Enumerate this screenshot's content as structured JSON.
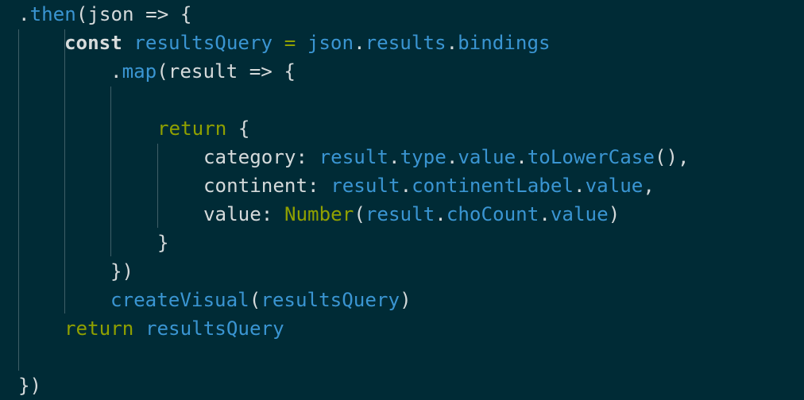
{
  "editor": {
    "theme": {
      "background": "#002b36",
      "text": "#d5dadb",
      "identifier": "#3a95d2",
      "keyword_green": "#8fa000",
      "indent_guide": "#3f5f68"
    },
    "lines": [
      {
        "indent": 0,
        "tokens": [
          {
            "t": ".",
            "c": "plain"
          },
          {
            "t": "then",
            "c": "blue"
          },
          {
            "t": "(json => {",
            "c": "plain"
          }
        ]
      },
      {
        "indent": 2,
        "tokens": [
          {
            "t": "const",
            "c": "keyword"
          },
          {
            "t": " ",
            "c": "plain"
          },
          {
            "t": "resultsQuery",
            "c": "blue"
          },
          {
            "t": " ",
            "c": "plain"
          },
          {
            "t": "=",
            "c": "green"
          },
          {
            "t": " ",
            "c": "plain"
          },
          {
            "t": "json",
            "c": "blue"
          },
          {
            "t": ".",
            "c": "plain"
          },
          {
            "t": "results",
            "c": "blue"
          },
          {
            "t": ".",
            "c": "plain"
          },
          {
            "t": "bindings",
            "c": "blue"
          }
        ]
      },
      {
        "indent": 4,
        "tokens": [
          {
            "t": ".",
            "c": "plain"
          },
          {
            "t": "map",
            "c": "blue"
          },
          {
            "t": "(result => {",
            "c": "plain"
          }
        ]
      },
      {
        "indent": 4,
        "tokens": []
      },
      {
        "indent": 6,
        "tokens": [
          {
            "t": "return",
            "c": "green"
          },
          {
            "t": " {",
            "c": "plain"
          }
        ]
      },
      {
        "indent": 8,
        "tokens": [
          {
            "t": "category: ",
            "c": "plain"
          },
          {
            "t": "result",
            "c": "blue"
          },
          {
            "t": ".",
            "c": "plain"
          },
          {
            "t": "type",
            "c": "blue"
          },
          {
            "t": ".",
            "c": "plain"
          },
          {
            "t": "value",
            "c": "blue"
          },
          {
            "t": ".",
            "c": "plain"
          },
          {
            "t": "toLowerCase",
            "c": "blue"
          },
          {
            "t": "(),",
            "c": "plain"
          }
        ]
      },
      {
        "indent": 8,
        "tokens": [
          {
            "t": "continent: ",
            "c": "plain"
          },
          {
            "t": "result",
            "c": "blue"
          },
          {
            "t": ".",
            "c": "plain"
          },
          {
            "t": "continentLabel",
            "c": "blue"
          },
          {
            "t": ".",
            "c": "plain"
          },
          {
            "t": "value",
            "c": "blue"
          },
          {
            "t": ",",
            "c": "plain"
          }
        ]
      },
      {
        "indent": 8,
        "tokens": [
          {
            "t": "value: ",
            "c": "plain"
          },
          {
            "t": "Number",
            "c": "green"
          },
          {
            "t": "(",
            "c": "plain"
          },
          {
            "t": "result",
            "c": "blue"
          },
          {
            "t": ".",
            "c": "plain"
          },
          {
            "t": "choCount",
            "c": "blue"
          },
          {
            "t": ".",
            "c": "plain"
          },
          {
            "t": "value",
            "c": "blue"
          },
          {
            "t": ")",
            "c": "plain"
          }
        ]
      },
      {
        "indent": 6,
        "tokens": [
          {
            "t": "}",
            "c": "plain"
          }
        ]
      },
      {
        "indent": 4,
        "tokens": [
          {
            "t": "})",
            "c": "plain"
          }
        ]
      },
      {
        "indent": 4,
        "tokens": [
          {
            "t": "createVisual",
            "c": "blue"
          },
          {
            "t": "(",
            "c": "plain"
          },
          {
            "t": "resultsQuery",
            "c": "blue"
          },
          {
            "t": ")",
            "c": "plain"
          }
        ]
      },
      {
        "indent": 2,
        "tokens": [
          {
            "t": "return",
            "c": "green"
          },
          {
            "t": " ",
            "c": "plain"
          },
          {
            "t": "resultsQuery",
            "c": "blue"
          }
        ]
      },
      {
        "indent": 0,
        "tokens": []
      },
      {
        "indent": 0,
        "tokens": [
          {
            "t": "})",
            "c": "plain"
          }
        ]
      }
    ]
  }
}
